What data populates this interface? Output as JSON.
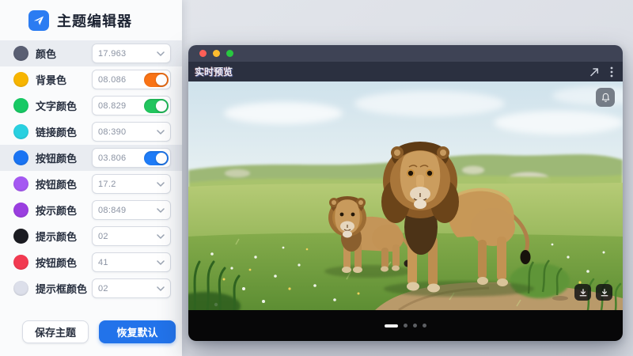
{
  "app": {
    "title": "主题编辑器",
    "logo_icon": "paper-plane-icon",
    "logo_color": "#2b7cf2"
  },
  "panel": {
    "rows": [
      {
        "label": "颜色",
        "value": "17.963",
        "control": "dropdown",
        "swatch_color": "#5a5f73",
        "highlighted": true
      },
      {
        "label": "背景色",
        "value": "08.086",
        "control": "toggle",
        "swatch_color": "#f7b500",
        "toggle_on": true,
        "toggle_color": "#f97316",
        "highlighted": false
      },
      {
        "label": "文字颜色",
        "value": "08.829",
        "control": "toggle",
        "swatch_color": "#17c964",
        "toggle_on": true,
        "toggle_color": "#22c55e",
        "highlighted": false
      },
      {
        "label": "链接颜色",
        "value": "08:390",
        "control": "dropdown",
        "swatch_color": "#29d0e0",
        "highlighted": false
      },
      {
        "label": "按钮颜色",
        "value": "03.806",
        "control": "toggle",
        "swatch_color": "#1a74f3",
        "toggle_on": true,
        "toggle_color": "#1f7cf7",
        "highlighted": true
      },
      {
        "label": "按钮颜色",
        "value": "17.2",
        "control": "dropdown",
        "swatch_color": "#a558f2",
        "highlighted": false
      },
      {
        "label": "按示颜色",
        "value": "08:849",
        "control": "dropdown",
        "swatch_color": "#9a3ee0",
        "highlighted": false
      },
      {
        "label": "提示颜色",
        "value": "02",
        "control": "dropdown",
        "swatch_color": "#1b1c22",
        "highlighted": false
      },
      {
        "label": "按钮颜色",
        "value": "41",
        "control": "dropdown",
        "swatch_color": "#f23a51",
        "highlighted": false
      },
      {
        "label": "提示框颜色",
        "value": "02",
        "control": "dropdown",
        "swatch_color": "#dcdfea",
        "highlighted": false
      }
    ],
    "actions": {
      "save_label": "保存主题",
      "reset_label": "恢复默认",
      "reset_color": "#2273ea"
    }
  },
  "preview": {
    "window_title": "实时预览",
    "traffic_lights": [
      "#ff5f57",
      "#febc2e",
      "#28c840"
    ],
    "header_icons": [
      "share-arrow-icon",
      "kebab-menu-icon"
    ],
    "overlays": {
      "bell": "bell-icon",
      "downloads": [
        "download-icon",
        "download-icon"
      ]
    },
    "pagination": {
      "total": 4,
      "active_index": 0
    },
    "image_description": "Two lions (large maned male and smaller young lion) standing in a green flowered meadow with rolling hills, pale blue sky and a dirt path"
  }
}
